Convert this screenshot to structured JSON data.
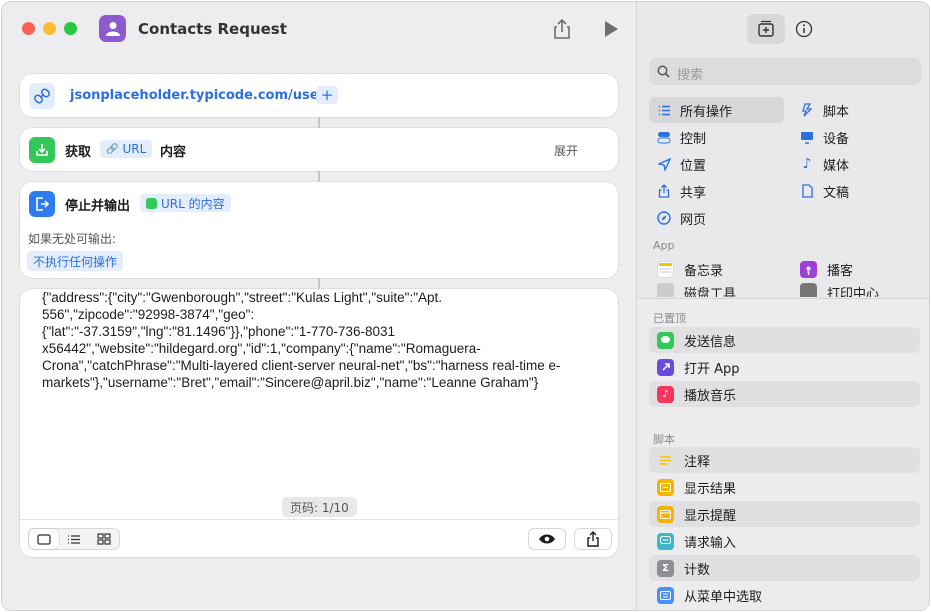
{
  "window": {
    "title": "Contacts Request"
  },
  "url_action": {
    "url": "jsonplaceholder.typicode.com/users",
    "add": "+"
  },
  "get_action": {
    "verb": "获取",
    "token": "URL",
    "suffix": "内容",
    "expand": "展开"
  },
  "stop_action": {
    "label": "停止并输出",
    "token": "URL 的内容",
    "fallback_label": "如果无处可输出:",
    "fallback_value": "不执行任何操作"
  },
  "output": {
    "text": "{\"address\":{\"city\":\"Gwenborough\",\"street\":\"Kulas Light\",\"suite\":\"Apt.\n556\",\"zipcode\":\"92998-3874\",\"geo\":\n{\"lat\":\"-37.3159\",\"lng\":\"81.1496\"}},\"phone\":\"1-770-736-8031\nx56442\",\"website\":\"hildegard.org\",\"id\":1,\"company\":{\"name\":\"Romaguera-\nCrona\",\"catchPhrase\":\"Multi-layered client-server neural-net\",\"bs\":\"harness real-time e-\nmarkets\"},\"username\":\"Bret\",\"email\":\"Sincere@april.biz\",\"name\":\"Leanne Graham\"}",
    "page": "页码: 1/10"
  },
  "sidebar": {
    "search_placeholder": "搜索",
    "categories": [
      {
        "label": "所有操作",
        "icon": "list-icon"
      },
      {
        "label": "脚本",
        "icon": "script-icon"
      },
      {
        "label": "控制",
        "icon": "toggle-icon"
      },
      {
        "label": "设备",
        "icon": "display-icon"
      },
      {
        "label": "位置",
        "icon": "location-icon"
      },
      {
        "label": "媒体",
        "icon": "music-note-icon"
      },
      {
        "label": "共享",
        "icon": "share-icon"
      },
      {
        "label": "文稿",
        "icon": "doc-icon"
      },
      {
        "label": "网页",
        "icon": "compass-icon"
      }
    ],
    "app_section": "App",
    "apps": [
      {
        "label": "备忘录"
      },
      {
        "label": "播客"
      },
      {
        "label": "磁盘工具"
      },
      {
        "label": "打印中心"
      }
    ],
    "pinned_section": "已置顶",
    "pinned": [
      {
        "label": "发送信息",
        "color": "#34c759"
      },
      {
        "label": "打开 App",
        "color": "#6a4bd8"
      },
      {
        "label": "播放音乐",
        "color": "#f5365c"
      }
    ],
    "script_section": "脚本",
    "scripts": [
      {
        "label": "注释",
        "color": "#f5c400"
      },
      {
        "label": "显示结果",
        "color": "#f5b400"
      },
      {
        "label": "显示提醒",
        "color": "#f5b400"
      },
      {
        "label": "请求输入",
        "color": "#3eb8c9"
      },
      {
        "label": "计数",
        "color": "#8e8e93"
      },
      {
        "label": "从菜单中选取",
        "color": "#4a8ff5"
      }
    ]
  }
}
